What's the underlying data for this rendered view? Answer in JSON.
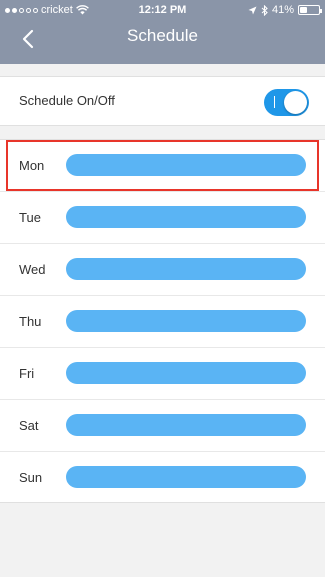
{
  "status_bar": {
    "carrier": "cricket",
    "time": "12:12 PM",
    "battery": "41%",
    "battery_level": 0.41
  },
  "header": {
    "title": "Schedule",
    "back_icon": "chevron-left-icon"
  },
  "schedule_toggle": {
    "label": "Schedule On/Off",
    "state": "on"
  },
  "days": [
    {
      "label": "Mon"
    },
    {
      "label": "Tue"
    },
    {
      "label": "Wed"
    },
    {
      "label": "Thu"
    },
    {
      "label": "Fri"
    },
    {
      "label": "Sat"
    },
    {
      "label": "Sun"
    }
  ],
  "colors": {
    "header": "#8a95a8",
    "accent": "#1f97e8",
    "day_bar": "#5ab4f4",
    "highlight": "#e8352a"
  }
}
